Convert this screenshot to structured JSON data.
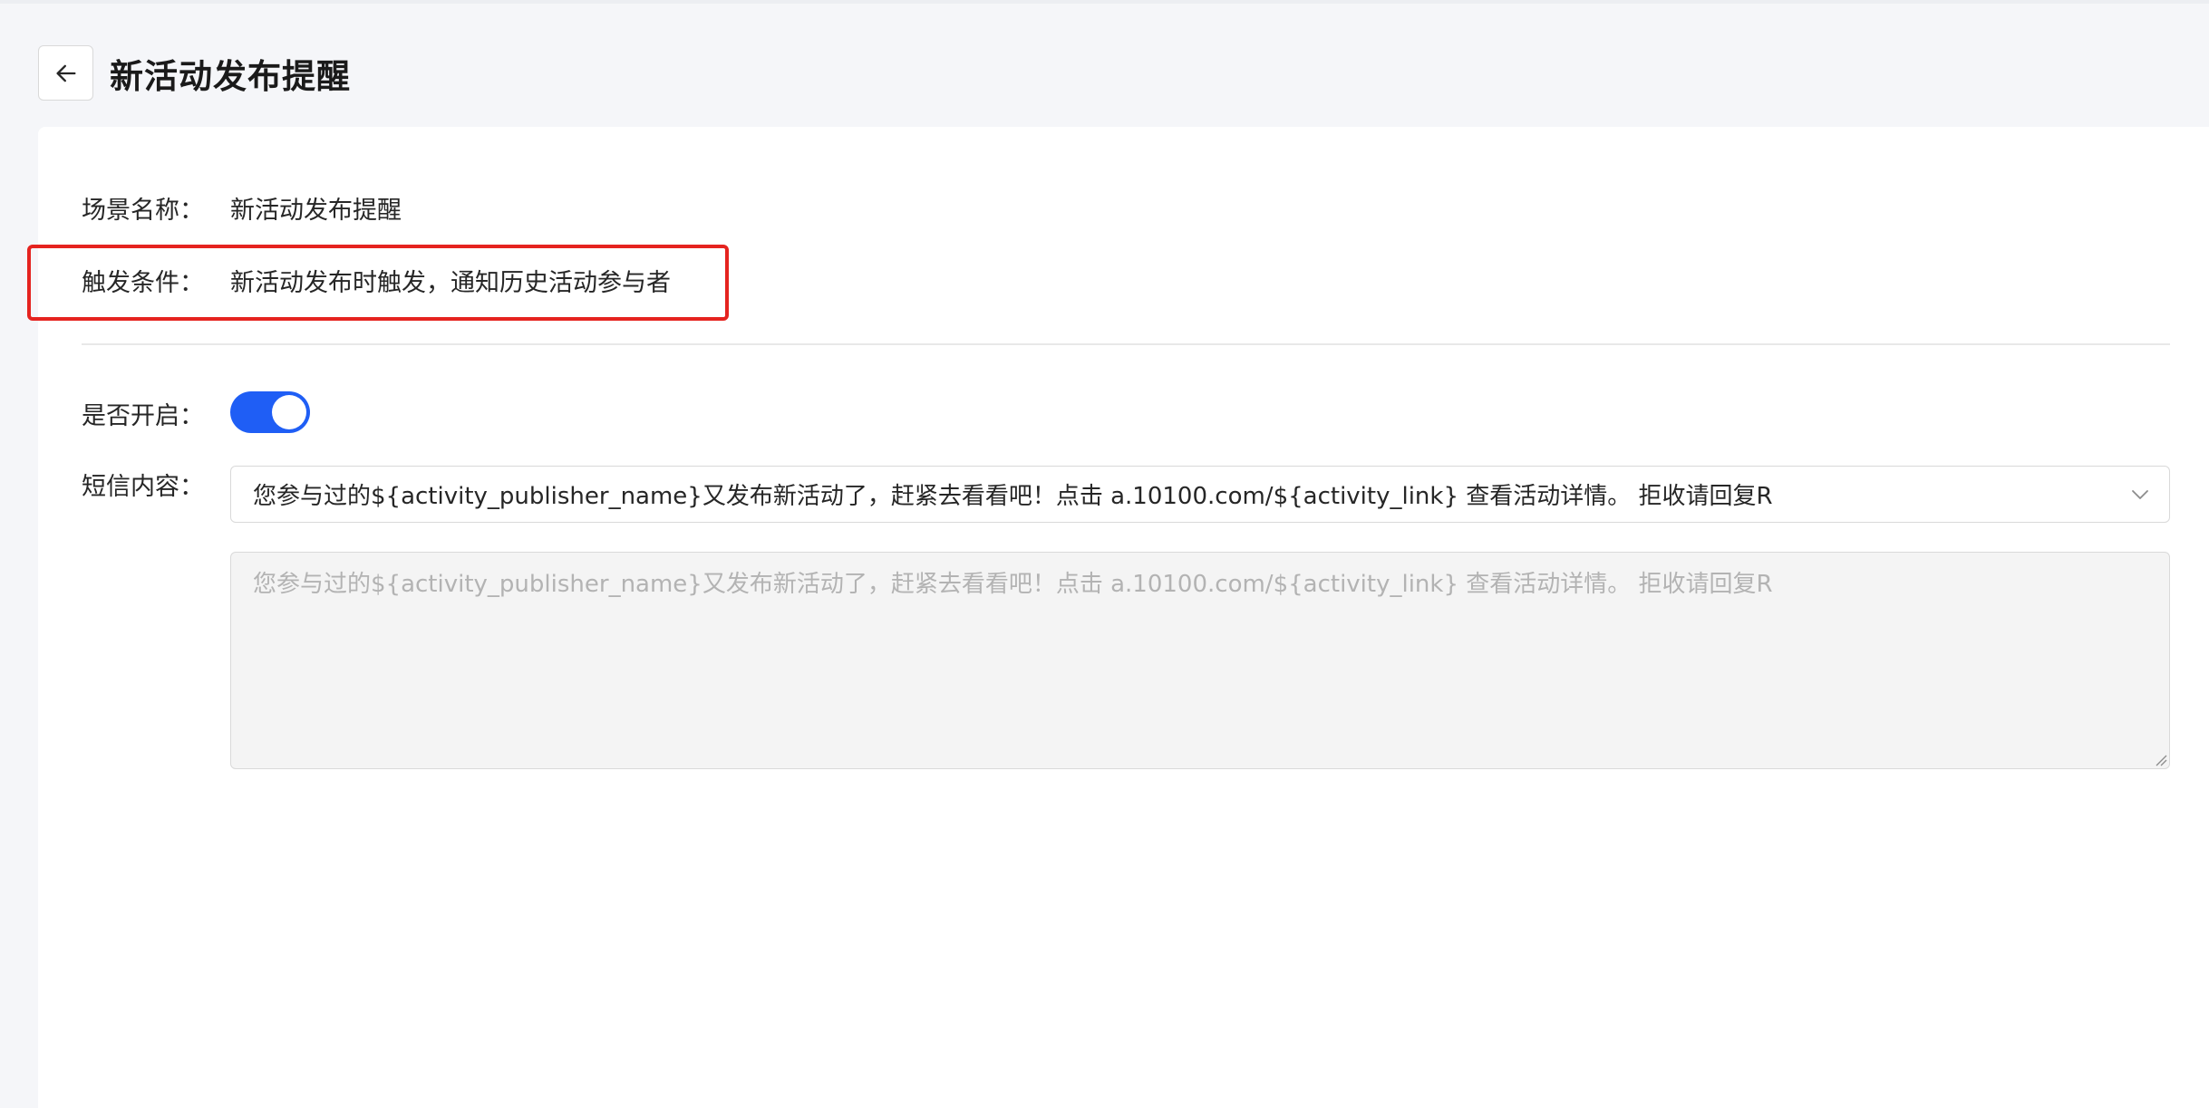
{
  "header": {
    "title": "新活动发布提醒"
  },
  "fields": {
    "scene_name_label": "场景名称：",
    "scene_name_value": "新活动发布提醒",
    "trigger_label": "触发条件：",
    "trigger_value": "新活动发布时触发，通知历史活动参与者",
    "enabled_label": "是否开启：",
    "enabled": true,
    "sms_label": "短信内容："
  },
  "sms": {
    "selected": "您参与过的${activity_publisher_name}又发布新活动了，赶紧去看看吧！点击 a.10100.com/${activity_link} 查看活动详情。 拒收请回复R",
    "textarea_placeholder": "您参与过的${activity_publisher_name}又发布新活动了，赶紧去看看吧！点击 a.10100.com/${activity_link} 查看活动详情。 拒收请回复R"
  },
  "colors": {
    "accent": "#1f5ef5",
    "highlight": "#e5231f"
  },
  "icons": {
    "back": "arrow-left-icon",
    "select": "chevron-down-icon"
  }
}
